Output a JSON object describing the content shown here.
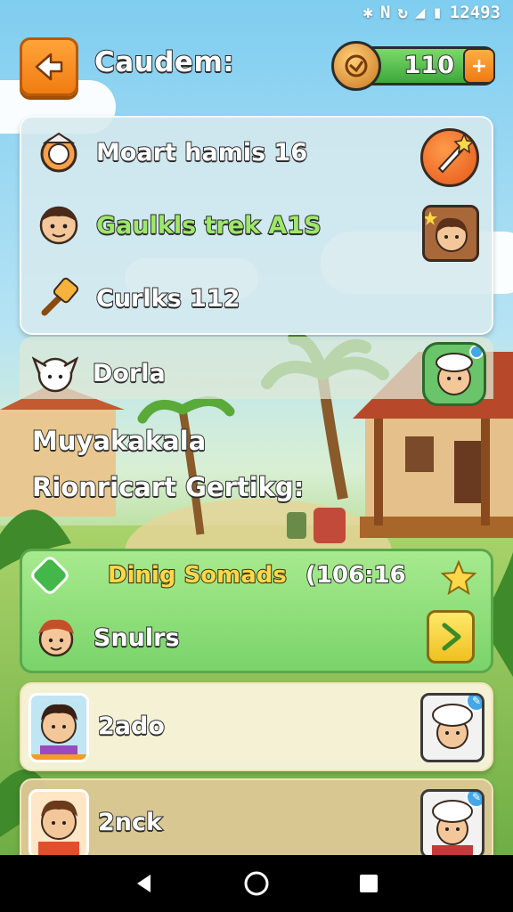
{
  "status_bar": {
    "time": "12493"
  },
  "header": {
    "title": "Caudem:",
    "coins": "110"
  },
  "top_panel": {
    "rows": [
      {
        "label": "Moart hamis 16"
      },
      {
        "label": "Gaulkls trek A1S"
      },
      {
        "label": "Curlks 112"
      }
    ]
  },
  "middle": {
    "name": "Dorla",
    "line1": "Muyakakala",
    "line2": "Rionricart Gertikg:"
  },
  "event": {
    "title": "Dinig Somads",
    "timer": "(106:16",
    "player": "Snulrs"
  },
  "list": [
    {
      "name": "2ado"
    },
    {
      "name": "2nck"
    }
  ],
  "colors": {
    "accent_orange": "#f07c10",
    "accent_green": "#7ad46a",
    "gold": "#ffd84a"
  }
}
